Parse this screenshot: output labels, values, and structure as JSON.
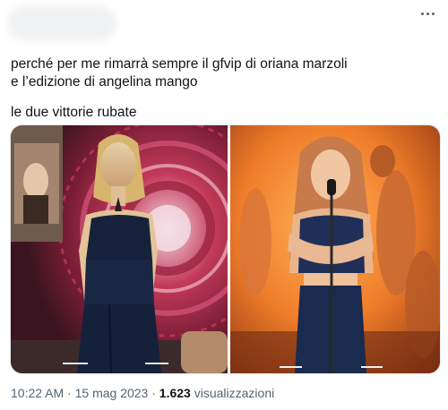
{
  "tweet": {
    "line1": "perché per me rimarrà sempre il gfvip di oriana marzoli",
    "line2": "e l’edizione di angelina mango",
    "line3": "le due vittorie rubate"
  },
  "meta": {
    "time": "10:22 AM",
    "separator": "·",
    "date": "15 mag 2023",
    "views_count": "1.623",
    "views_label": "visualizzazioni"
  },
  "icons": {
    "more": "more-dots-icon"
  }
}
